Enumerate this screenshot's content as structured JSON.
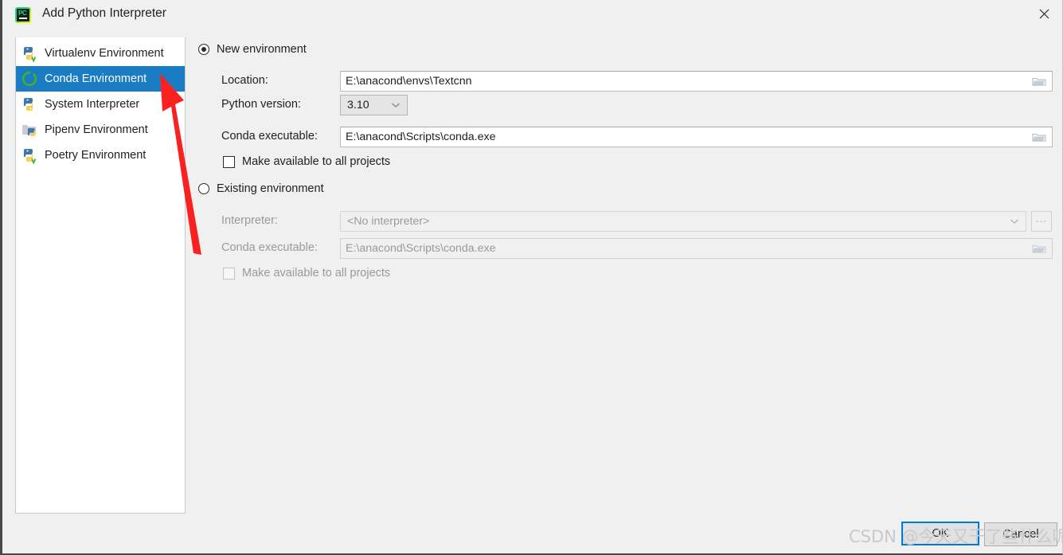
{
  "window": {
    "title": "Add Python Interpreter",
    "app_icon": "pycharm-icon",
    "close_icon": "close-icon"
  },
  "sidebar": {
    "items": [
      {
        "label": "Virtualenv Environment",
        "icon": "python-virtualenv-icon",
        "selected": false
      },
      {
        "label": "Conda Environment",
        "icon": "conda-icon",
        "selected": true
      },
      {
        "label": "System Interpreter",
        "icon": "python-icon",
        "selected": false
      },
      {
        "label": "Pipenv Environment",
        "icon": "pipenv-folder-icon",
        "selected": false
      },
      {
        "label": "Poetry Environment",
        "icon": "python-poetry-icon",
        "selected": false
      }
    ]
  },
  "main": {
    "new_environment": {
      "radio_label": "New environment",
      "selected": true,
      "location": {
        "label": "Location:",
        "value": "E:\\anacond\\envs\\Textcnn",
        "browse_icon": "folder-icon"
      },
      "python_version": {
        "label": "Python version:",
        "value": "3.10",
        "dropdown_icon": "chevron-down-icon"
      },
      "conda_executable": {
        "label": "Conda executable:",
        "value": "E:\\anacond\\Scripts\\conda.exe",
        "browse_icon": "folder-icon"
      },
      "make_available": {
        "label": "Make available to all projects",
        "checked": false
      }
    },
    "existing_environment": {
      "radio_label": "Existing environment",
      "selected": false,
      "interpreter": {
        "label": "Interpreter:",
        "value": "<No interpreter>",
        "dropdown_icon": "chevron-down-icon",
        "browse_label": "..."
      },
      "conda_executable": {
        "label": "Conda executable:",
        "value": "E:\\anacond\\Scripts\\conda.exe",
        "browse_icon": "folder-icon"
      },
      "make_available": {
        "label": "Make available to all projects",
        "checked": false
      }
    }
  },
  "footer": {
    "ok_label": "OK",
    "cancel_label": "Cancel"
  },
  "watermark": {
    "text": "CSDN @今天又干了些什么呢"
  },
  "colors": {
    "accent": "#1a7dc4",
    "default_button_border": "#0078d7",
    "annotation_arrow": "#fb2121",
    "conda_green": "#43b02a",
    "python_blue": "#3c78aa",
    "python_yellow": "#f5d04c"
  },
  "annotation": {
    "arrow": "red-arrow-pointing-to-conda-environment"
  }
}
